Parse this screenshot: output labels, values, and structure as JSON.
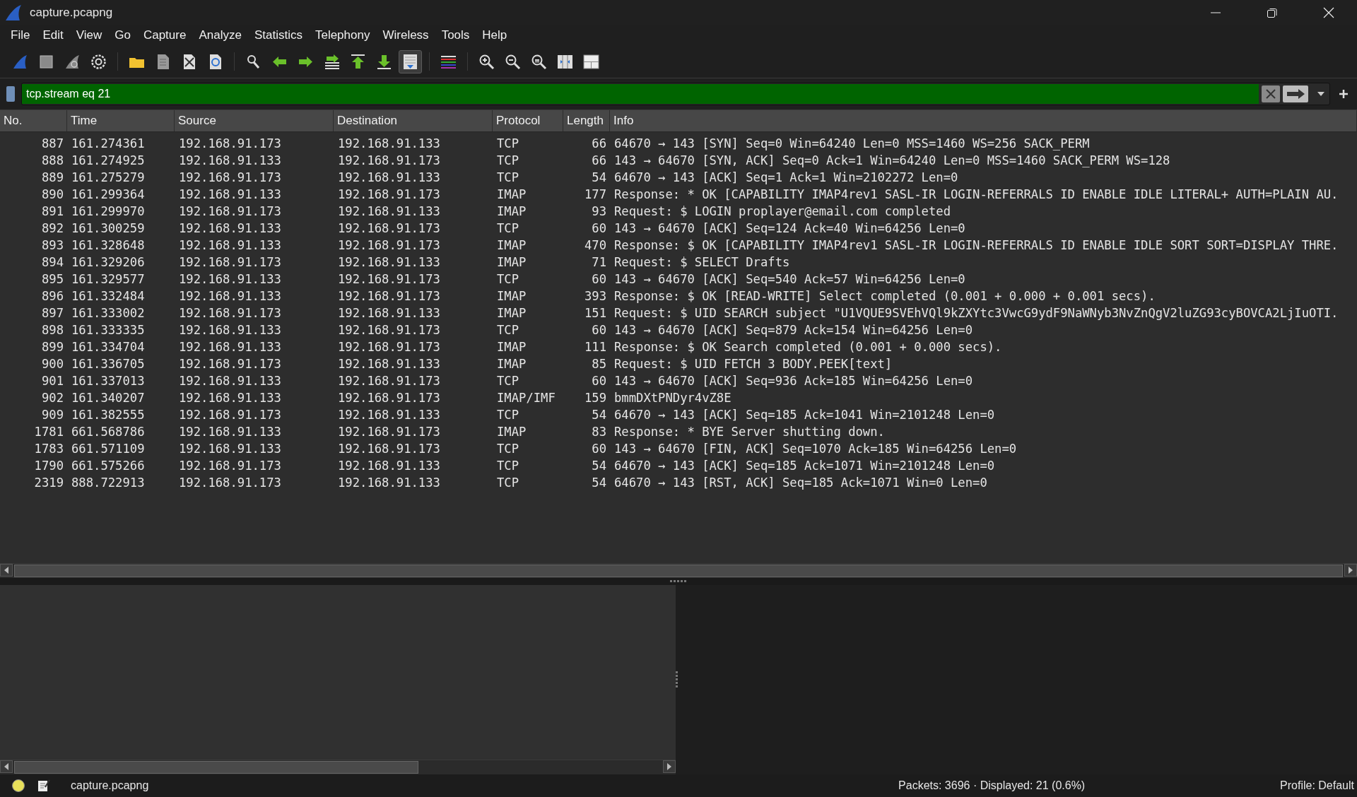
{
  "window": {
    "title": "capture.pcapng"
  },
  "menu": [
    "File",
    "Edit",
    "View",
    "Go",
    "Capture",
    "Analyze",
    "Statistics",
    "Telephony",
    "Wireless",
    "Tools",
    "Help"
  ],
  "toolbar_groups": [
    [
      {
        "kind": "fin",
        "pressed": false
      },
      {
        "kind": "stop",
        "pressed": false
      },
      {
        "kind": "restart",
        "pressed": false
      },
      {
        "kind": "options",
        "pressed": false
      }
    ],
    [
      {
        "kind": "open",
        "pressed": false
      },
      {
        "kind": "save",
        "pressed": false
      },
      {
        "kind": "close",
        "pressed": false
      },
      {
        "kind": "reload",
        "pressed": false
      }
    ],
    [
      {
        "kind": "find",
        "pressed": false
      },
      {
        "kind": "back",
        "pressed": false
      },
      {
        "kind": "forward",
        "pressed": false
      },
      {
        "kind": "goto",
        "pressed": false
      },
      {
        "kind": "first",
        "pressed": false
      },
      {
        "kind": "last",
        "pressed": false
      },
      {
        "kind": "autoscroll",
        "pressed": true
      }
    ],
    [
      {
        "kind": "colorize",
        "pressed": false
      }
    ],
    [
      {
        "kind": "zoomin",
        "pressed": false
      },
      {
        "kind": "zoomout",
        "pressed": false
      },
      {
        "kind": "zoomreset",
        "pressed": false
      },
      {
        "kind": "resize",
        "pressed": false
      },
      {
        "kind": "layout",
        "pressed": false
      }
    ]
  ],
  "filter": {
    "value": "tcp.stream eq 21"
  },
  "table": {
    "columns": [
      "No.",
      "Time",
      "Source",
      "Destination",
      "Protocol",
      "Length",
      "Info"
    ],
    "rows": [
      [
        "887",
        "161.274361",
        "192.168.91.173",
        "192.168.91.133",
        "TCP",
        "66",
        "64670 → 143 [SYN] Seq=0 Win=64240 Len=0 MSS=1460 WS=256 SACK_PERM"
      ],
      [
        "888",
        "161.274925",
        "192.168.91.133",
        "192.168.91.173",
        "TCP",
        "66",
        "143 → 64670 [SYN, ACK] Seq=0 Ack=1 Win=64240 Len=0 MSS=1460 SACK_PERM WS=128"
      ],
      [
        "889",
        "161.275279",
        "192.168.91.173",
        "192.168.91.133",
        "TCP",
        "54",
        "64670 → 143 [ACK] Seq=1 Ack=1 Win=2102272 Len=0"
      ],
      [
        "890",
        "161.299364",
        "192.168.91.133",
        "192.168.91.173",
        "IMAP",
        "177",
        "Response: * OK [CAPABILITY IMAP4rev1 SASL-IR LOGIN-REFERRALS ID ENABLE IDLE LITERAL+ AUTH=PLAIN AU."
      ],
      [
        "891",
        "161.299970",
        "192.168.91.173",
        "192.168.91.133",
        "IMAP",
        "93",
        "Request: $ LOGIN proplayer@email.com completed"
      ],
      [
        "892",
        "161.300259",
        "192.168.91.133",
        "192.168.91.173",
        "TCP",
        "60",
        "143 → 64670 [ACK] Seq=124 Ack=40 Win=64256 Len=0"
      ],
      [
        "893",
        "161.328648",
        "192.168.91.133",
        "192.168.91.173",
        "IMAP",
        "470",
        "Response: $ OK [CAPABILITY IMAP4rev1 SASL-IR LOGIN-REFERRALS ID ENABLE IDLE SORT SORT=DISPLAY THRE."
      ],
      [
        "894",
        "161.329206",
        "192.168.91.173",
        "192.168.91.133",
        "IMAP",
        "71",
        "Request: $ SELECT Drafts"
      ],
      [
        "895",
        "161.329577",
        "192.168.91.133",
        "192.168.91.173",
        "TCP",
        "60",
        "143 → 64670 [ACK] Seq=540 Ack=57 Win=64256 Len=0"
      ],
      [
        "896",
        "161.332484",
        "192.168.91.133",
        "192.168.91.173",
        "IMAP",
        "393",
        "Response: $ OK [READ-WRITE] Select completed (0.001 + 0.000 + 0.001 secs)."
      ],
      [
        "897",
        "161.333002",
        "192.168.91.173",
        "192.168.91.133",
        "IMAP",
        "151",
        "Request: $ UID SEARCH subject \"U1VQUE9SVEhVQl9kZXYtc3VwcG9ydF9NaWNyb3NvZnQgV2luZG93cyBOVCA2LjIuOTI."
      ],
      [
        "898",
        "161.333335",
        "192.168.91.133",
        "192.168.91.173",
        "TCP",
        "60",
        "143 → 64670 [ACK] Seq=879 Ack=154 Win=64256 Len=0"
      ],
      [
        "899",
        "161.334704",
        "192.168.91.133",
        "192.168.91.173",
        "IMAP",
        "111",
        "Response: $ OK Search completed (0.001 + 0.000 secs)."
      ],
      [
        "900",
        "161.336705",
        "192.168.91.173",
        "192.168.91.133",
        "IMAP",
        "85",
        "Request: $ UID FETCH 3 BODY.PEEK[text]"
      ],
      [
        "901",
        "161.337013",
        "192.168.91.133",
        "192.168.91.173",
        "TCP",
        "60",
        "143 → 64670 [ACK] Seq=936 Ack=185 Win=64256 Len=0"
      ],
      [
        "902",
        "161.340207",
        "192.168.91.133",
        "192.168.91.173",
        "IMAP/IMF",
        "159",
        "bmmDXtPNDyr4vZ8E"
      ],
      [
        "909",
        "161.382555",
        "192.168.91.173",
        "192.168.91.133",
        "TCP",
        "54",
        "64670 → 143 [ACK] Seq=185 Ack=1041 Win=2101248 Len=0"
      ],
      [
        "1781",
        "661.568786",
        "192.168.91.133",
        "192.168.91.173",
        "IMAP",
        "83",
        "Response: * BYE Server shutting down."
      ],
      [
        "1783",
        "661.571109",
        "192.168.91.133",
        "192.168.91.173",
        "TCP",
        "60",
        "143 → 64670 [FIN, ACK] Seq=1070 Ack=185 Win=64256 Len=0"
      ],
      [
        "1790",
        "661.575266",
        "192.168.91.173",
        "192.168.91.133",
        "TCP",
        "54",
        "64670 → 143 [ACK] Seq=185 Ack=1071 Win=2101248 Len=0"
      ],
      [
        "2319",
        "888.722913",
        "192.168.91.173",
        "192.168.91.133",
        "TCP",
        "54",
        "64670 → 143 [RST, ACK] Seq=185 Ack=1071 Win=0 Len=0"
      ]
    ]
  },
  "status_bar": {
    "file": "capture.pcapng",
    "packets": "Packets: 3696 · Displayed: 21 (0.6%)",
    "profile": "Profile: Default"
  }
}
